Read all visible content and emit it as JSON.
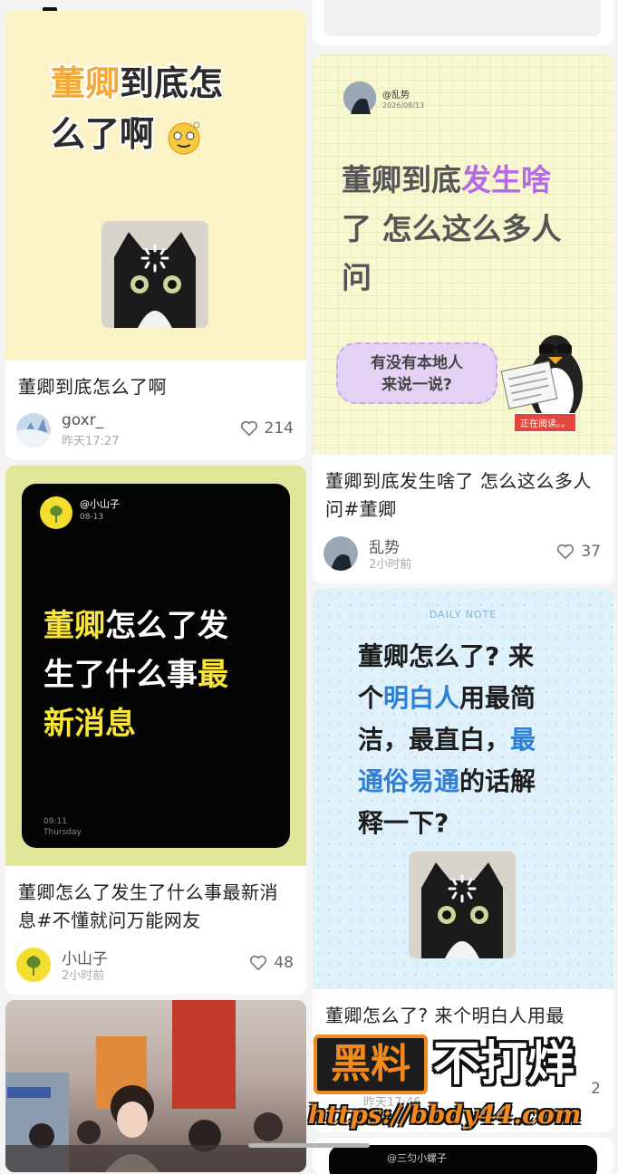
{
  "colors": {
    "page_bg": "#f3f3f3",
    "card_bg": "#ffffff",
    "cover_yellow": "#fbf3c6",
    "cover_green_yellow": "#dfe69a",
    "cover_pale_yellow": "#f8f8d0",
    "cover_light_blue": "#dff1fb",
    "highlight_orange": "#f0a93a",
    "highlight_purple": "#b469e6",
    "highlight_yellow": "#f7e53c",
    "highlight_blue": "#2f7fd6",
    "watermark_orange": "#f08a1e"
  },
  "posts": [
    {
      "cover_line1_highlight": "董卿",
      "cover_line1_rest": "到底怎",
      "cover_line2": "么了啊",
      "title": "董卿到底怎么了啊",
      "author": "goxr_",
      "time": "昨天17:27",
      "likes": "214"
    },
    {
      "handle": "@乱势",
      "date": "2026/08/13",
      "cover_line1_plain": "董卿到底",
      "cover_line1_highlight": "发生啥",
      "cover_line2": "了 怎么这么多人",
      "cover_line3": "问",
      "bubble_line1": "有没有本地人",
      "bubble_line2": "来说一说?",
      "badge": "正在阅读。。",
      "title": "董卿到底发生啥了 怎么这么多人问#董卿",
      "author": "乱势",
      "time": "2小时前",
      "likes": "37"
    },
    {
      "handle": "@小山子",
      "date": "08-13",
      "cover_line1_highlight": "董卿",
      "cover_line1_rest": "怎么了发",
      "cover_line2_plain": "生了什么事",
      "cover_line2_highlight": "最",
      "cover_line3": "新消息",
      "clock_time": "09:11",
      "clock_day": "Thursday",
      "title": "董卿怎么了发生了什么事最新消息#不懂就问万能网友",
      "author": "小山子",
      "time": "2小时前",
      "likes": "48"
    },
    {
      "daily_note": "DAILY NOTE",
      "line1": "董卿怎么了? 来",
      "line2_a": "个",
      "line2_b": "明白人",
      "line2_c": "用最简",
      "line3_a": "洁，最直白，",
      "line3_b": "最",
      "line4_a": "通俗易通",
      "line4_b": "的话解",
      "line5": "释一下?",
      "title": "董卿怎么了? 来个明白人用最",
      "time_partial": "昨天17:46",
      "likes_partial": "2"
    },
    {
      "handle_partial": "@三匀小螺子"
    }
  ],
  "watermark": {
    "box_text": "黑料",
    "right_text": "不打烊",
    "url": "https://bbdy44.com"
  }
}
